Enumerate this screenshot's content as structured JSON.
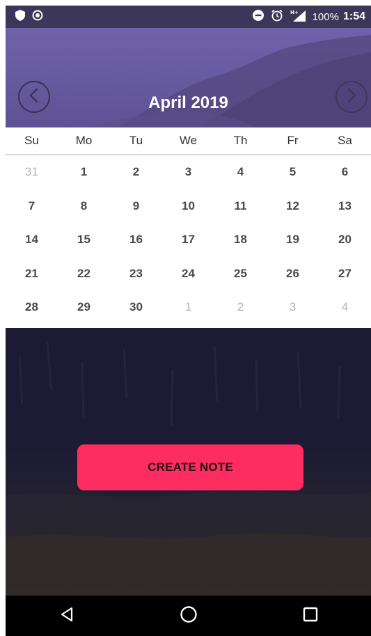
{
  "status_bar": {
    "icons_left": [
      "shield-icon",
      "record-icon"
    ],
    "icons_right": [
      "do-not-disturb-icon",
      "alarm-icon",
      "signal-hplus-icon"
    ],
    "battery_text": "100%",
    "time": "1:54"
  },
  "header": {
    "month_title": "April 2019",
    "prev_icon": "chevron-left-icon",
    "next_icon": "chevron-right-icon"
  },
  "calendar": {
    "weekdays": [
      "Su",
      "Mo",
      "Tu",
      "We",
      "Th",
      "Fr",
      "Sa"
    ],
    "weeks": [
      [
        {
          "d": "31",
          "other": true
        },
        {
          "d": "1"
        },
        {
          "d": "2"
        },
        {
          "d": "3"
        },
        {
          "d": "4"
        },
        {
          "d": "5"
        },
        {
          "d": "6"
        }
      ],
      [
        {
          "d": "7"
        },
        {
          "d": "8"
        },
        {
          "d": "9"
        },
        {
          "d": "10"
        },
        {
          "d": "11"
        },
        {
          "d": "12"
        },
        {
          "d": "13"
        }
      ],
      [
        {
          "d": "14"
        },
        {
          "d": "15"
        },
        {
          "d": "16"
        },
        {
          "d": "17"
        },
        {
          "d": "18"
        },
        {
          "d": "19"
        },
        {
          "d": "20"
        }
      ],
      [
        {
          "d": "21"
        },
        {
          "d": "22"
        },
        {
          "d": "23"
        },
        {
          "d": "24"
        },
        {
          "d": "25"
        },
        {
          "d": "26"
        },
        {
          "d": "27"
        }
      ],
      [
        {
          "d": "28"
        },
        {
          "d": "29"
        },
        {
          "d": "30"
        },
        {
          "d": "1",
          "other": true
        },
        {
          "d": "2",
          "other": true
        },
        {
          "d": "3",
          "other": true
        },
        {
          "d": "4",
          "other": true
        }
      ]
    ]
  },
  "actions": {
    "create_note_label": "CREATE NOTE"
  },
  "nav_bar": {
    "items": [
      "back-icon",
      "home-icon",
      "recents-icon"
    ]
  },
  "colors": {
    "accent": "#fd2d62",
    "header": "#665a9f",
    "status_bar": "#3c3658"
  }
}
